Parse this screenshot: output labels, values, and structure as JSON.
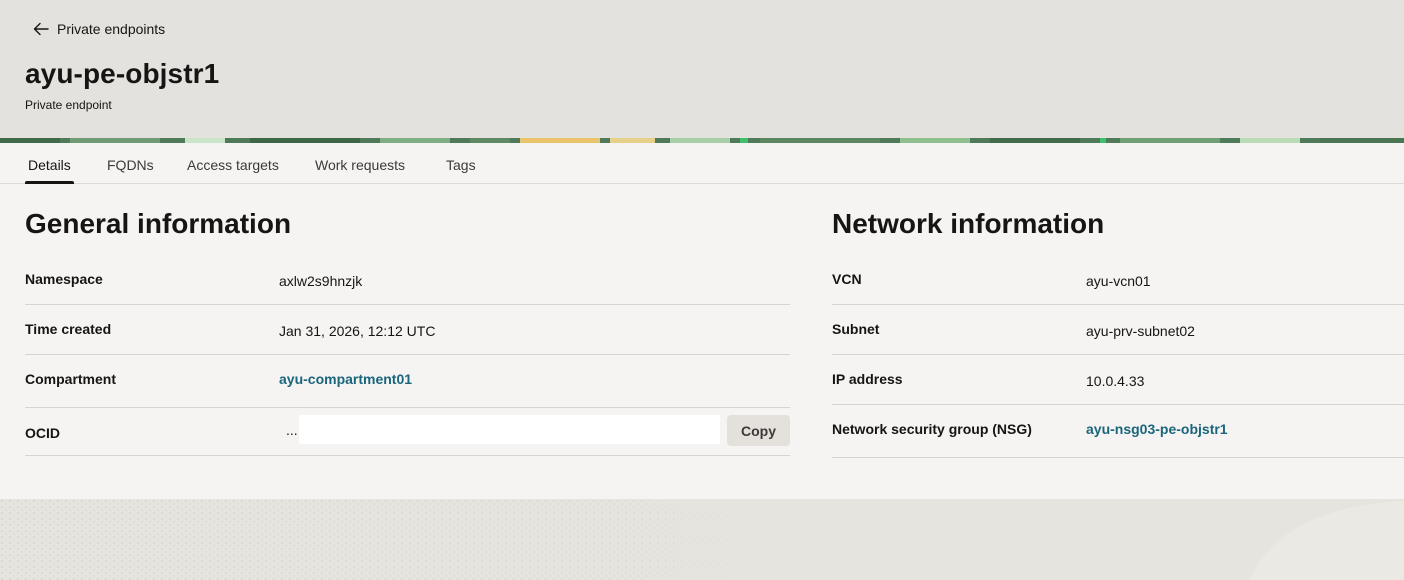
{
  "header": {
    "back_label": "Private endpoints",
    "title": "ayu-pe-objstr1",
    "subtitle": "Private endpoint"
  },
  "tabs": [
    {
      "label": "Details",
      "active": true
    },
    {
      "label": "FQDNs",
      "active": false
    },
    {
      "label": "Access targets",
      "active": false
    },
    {
      "label": "Work requests",
      "active": false
    },
    {
      "label": "Tags",
      "active": false
    }
  ],
  "general": {
    "title": "General information",
    "namespace_label": "Namespace",
    "namespace_value": "axlw2s9hnzjk",
    "time_created_label": "Time created",
    "time_created_value": "Jan 31, 2026, 12:12 UTC",
    "compartment_label": "Compartment",
    "compartment_value": "ayu-compartment01",
    "ocid_label": "OCID",
    "ocid_ellipsis": "...",
    "ocid_value": "",
    "copy_label": "Copy"
  },
  "network": {
    "title": "Network information",
    "vcn_label": "VCN",
    "vcn_value": "ayu-vcn01",
    "subnet_label": "Subnet",
    "subnet_value": "ayu-prv-subnet02",
    "ip_label": "IP address",
    "ip_value": "10.0.4.33",
    "nsg_label": "Network security group (NSG)",
    "nsg_value": "ayu-nsg03-pe-objstr1"
  },
  "colors": {
    "link": "#19657c",
    "banner_green": "#4f7a5a",
    "banner_light": "#a9cfa9",
    "banner_yellow": "#e9c46a"
  },
  "icons": {
    "back": "arrow-left-icon"
  }
}
